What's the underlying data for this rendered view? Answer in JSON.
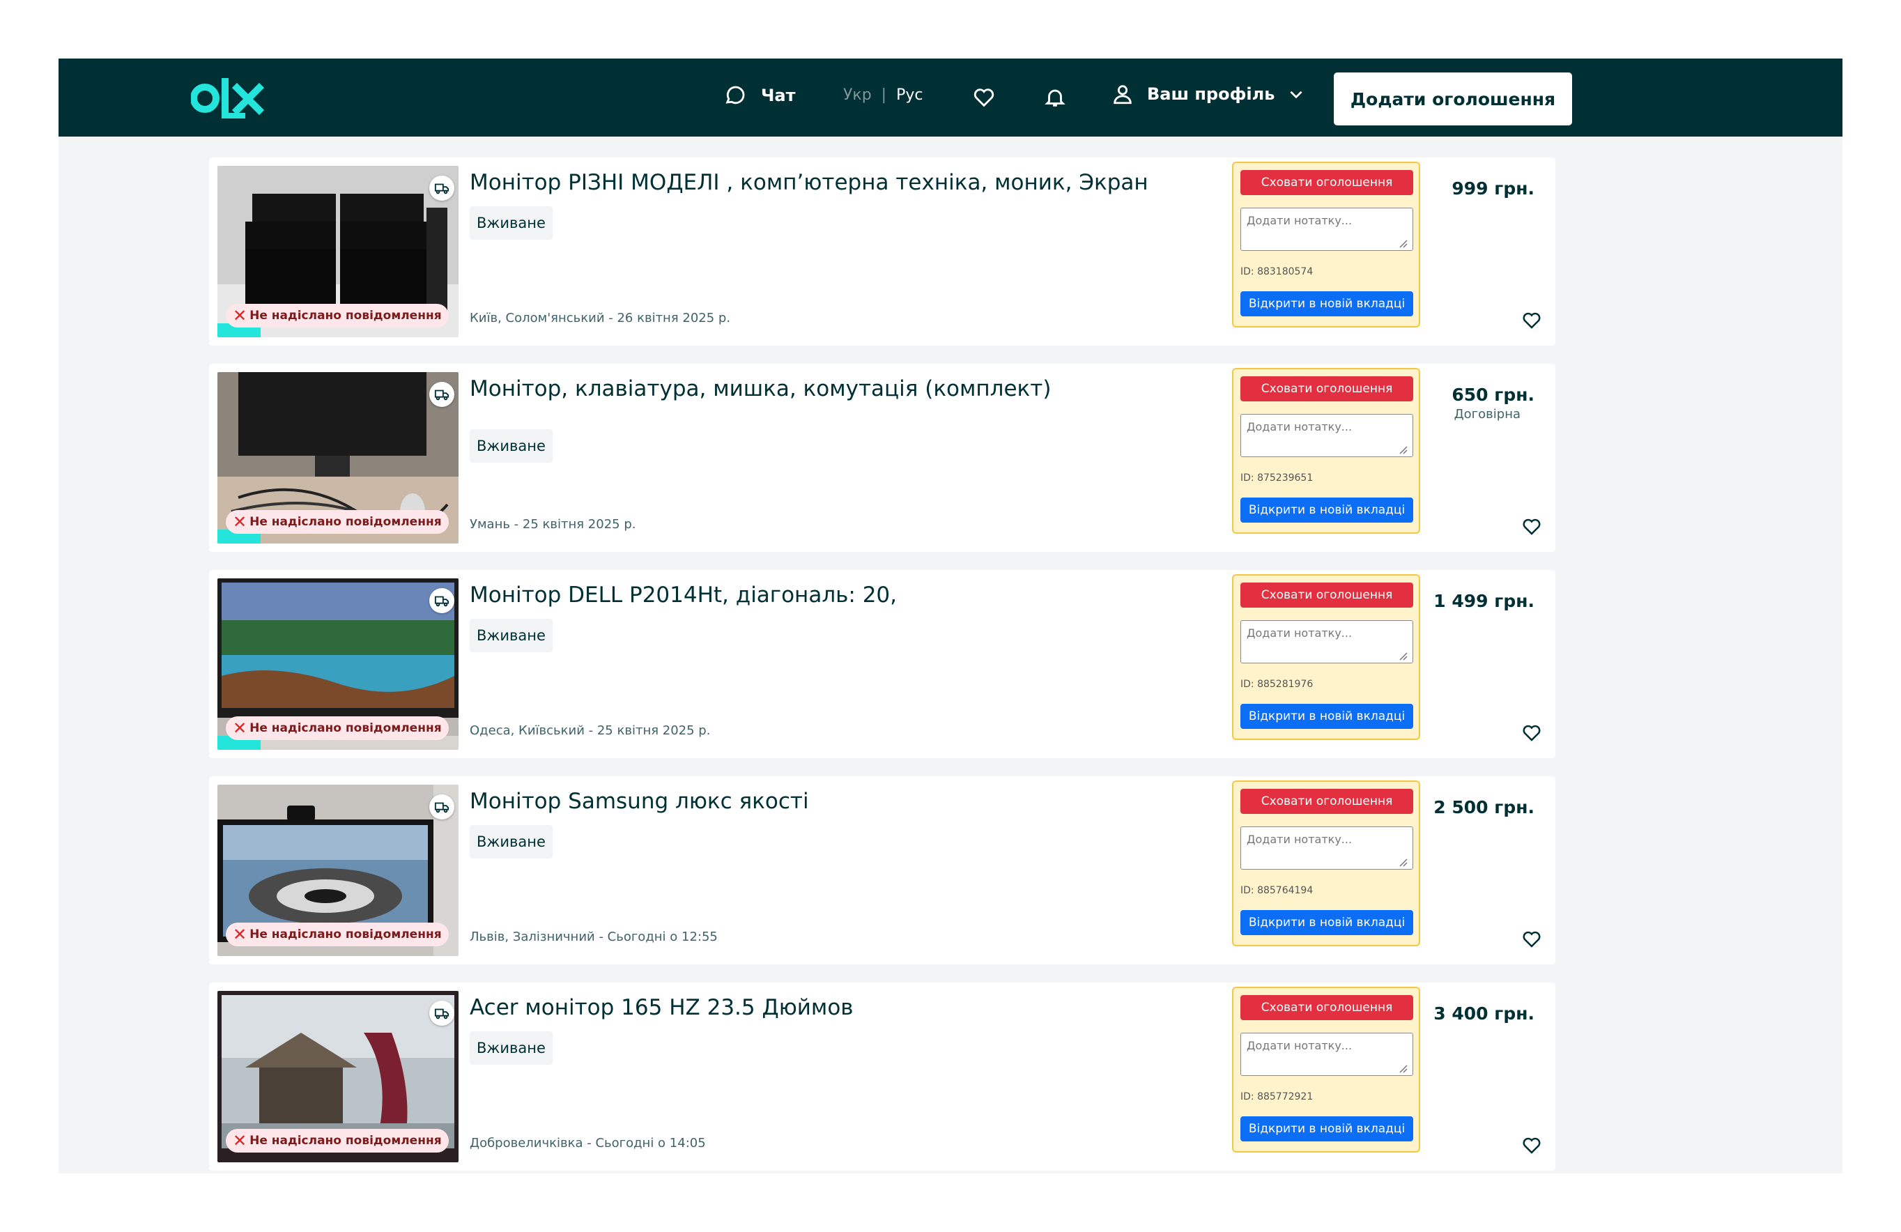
{
  "header": {
    "chat_label": "Чат",
    "lang_ukr": "Укр",
    "lang_sep": "|",
    "lang_rus": "Рус",
    "profile_label": "Ваш профіль",
    "add_button_label": "Додати оголошення"
  },
  "colors": {
    "header_bg": "#002f34",
    "logo_accent": "#23e5db",
    "hide_button": "#e33040",
    "open_button": "#0b6ef5",
    "panel_bg": "#fff3cc"
  },
  "listings": [
    {
      "title": "Монітор РІЗНІ МОДЕЛІ , комп’ютерна техніка, моник, Экран",
      "condition": "Вживане",
      "location": "Київ, Солом'янський - 26 квітня 2025 р.",
      "price": "999 грн.",
      "negotiable": "",
      "ad_id": "ID: 883180574",
      "not_sent": "Не надіслано повідомлення",
      "hide_label": "Сховати оголошення",
      "note_placeholder": "Додати нотатку...",
      "open_label": "Відкрити в новій вкладці"
    },
    {
      "title": "Монітор, клавіатура, мишка, комутація (комплект)",
      "condition": "Вживане",
      "location": "Умань - 25 квітня 2025 р.",
      "price": "650 грн.",
      "negotiable": "Договірна",
      "ad_id": "ID: 875239651",
      "not_sent": "Не надіслано повідомлення",
      "hide_label": "Сховати оголошення",
      "note_placeholder": "Додати нотатку...",
      "open_label": "Відкрити в новій вкладці"
    },
    {
      "title": "Монітор DELL P2014Ht, діагональ: 20,",
      "condition": "Вживане",
      "location": "Одеса, Київський - 25 квітня 2025 р.",
      "price": "1 499 грн.",
      "negotiable": "",
      "ad_id": "ID: 885281976",
      "not_sent": "Не надіслано повідомлення",
      "hide_label": "Сховати оголошення",
      "note_placeholder": "Додати нотатку...",
      "open_label": "Відкрити в новій вкладці"
    },
    {
      "title": "Монітор Samsung люкс якості",
      "condition": "Вживане",
      "location": "Львів, Залізничний - Сьогодні о 12:55",
      "price": "2 500 грн.",
      "negotiable": "",
      "ad_id": "ID: 885764194",
      "not_sent": "Не надіслано повідомлення",
      "hide_label": "Сховати оголошення",
      "note_placeholder": "Додати нотатку...",
      "open_label": "Відкрити в новій вкладці"
    },
    {
      "title": "Acer монітор 165 HZ 23.5 Дюймов",
      "condition": "Вживане",
      "location": "Добровеличківка - Сьогодні о 14:05",
      "price": "3 400 грн.",
      "negotiable": "",
      "ad_id": "ID: 885772921",
      "not_sent": "Не надіслано повідомлення",
      "hide_label": "Сховати оголошення",
      "note_placeholder": "Додати нотатку...",
      "open_label": "Відкрити в новій вкладці"
    }
  ]
}
